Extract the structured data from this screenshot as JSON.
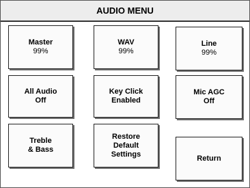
{
  "title": "AUDIO MENU",
  "buttons": {
    "master": {
      "line1": "Master",
      "line2": "99%"
    },
    "wav": {
      "line1": "WAV",
      "line2": "99%"
    },
    "line": {
      "line1": "Line",
      "line2": "99%"
    },
    "all_audio": {
      "line1": "All Audio",
      "line2": "Off"
    },
    "key_click": {
      "line1": "Key Click",
      "line2": "Enabled"
    },
    "mic_agc": {
      "line1": "Mic AGC",
      "line2": "Off"
    },
    "treble_bass": {
      "line1": "Treble",
      "line2": "& Bass"
    },
    "restore": {
      "line1": "Restore",
      "line2": "Default",
      "line3": "Settings"
    },
    "return": {
      "line1": "Return"
    }
  }
}
